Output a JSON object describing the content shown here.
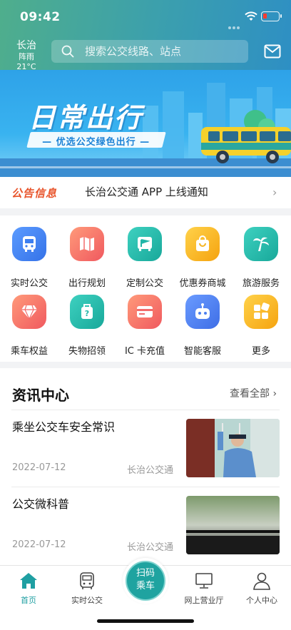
{
  "status_bar": {
    "time": "09:42"
  },
  "header": {
    "city": "长治",
    "weather": "阵雨 21°C",
    "search_placeholder": "搜索公交线路、站点"
  },
  "banner": {
    "title": "日常出行",
    "subtitle": "— 优选公交绿色出行 —"
  },
  "notice": {
    "tag": "公告信息",
    "text": "长治公交通 APP 上线通知"
  },
  "services": [
    {
      "label": "实时公交",
      "icon": "bus-icon",
      "color": "#3d7ff0"
    },
    {
      "label": "出行规划",
      "icon": "map-icon",
      "color": "#f26b6b"
    },
    {
      "label": "定制公交",
      "icon": "flag-bus-icon",
      "color": "#22b6a8"
    },
    {
      "label": "优惠券商城",
      "icon": "shopping-bag-icon",
      "color": "#f5b421"
    },
    {
      "label": "旅游服务",
      "icon": "palm-tree-icon",
      "color": "#22b6a8"
    },
    {
      "label": "乘车权益",
      "icon": "diamond-icon",
      "color": "#f26b6b"
    },
    {
      "label": "失物招领",
      "icon": "luggage-icon",
      "color": "#22b6a8"
    },
    {
      "label": "IC 卡充值",
      "icon": "card-icon",
      "color": "#f26b6b"
    },
    {
      "label": "智能客服",
      "icon": "robot-icon",
      "color": "#4c7ff0"
    },
    {
      "label": "更多",
      "icon": "grid-icon",
      "color": "#f5b421"
    }
  ],
  "news": {
    "title": "资讯中心",
    "more": "查看全部",
    "articles": [
      {
        "title": "乘坐公交车安全常识",
        "date": "2022-07-12",
        "source": "长治公交通"
      },
      {
        "title": "公交微科普",
        "date": "2022-07-12",
        "source": "长治公交通"
      }
    ]
  },
  "tabbar": {
    "items": [
      "首页",
      "实时公交",
      "网上营业厅",
      "个人中心"
    ],
    "scan": [
      "扫码",
      "乘车"
    ]
  },
  "colors": {
    "accent": "#1fa3a0",
    "notice": "#e8542b",
    "header": "#3b9fae"
  }
}
